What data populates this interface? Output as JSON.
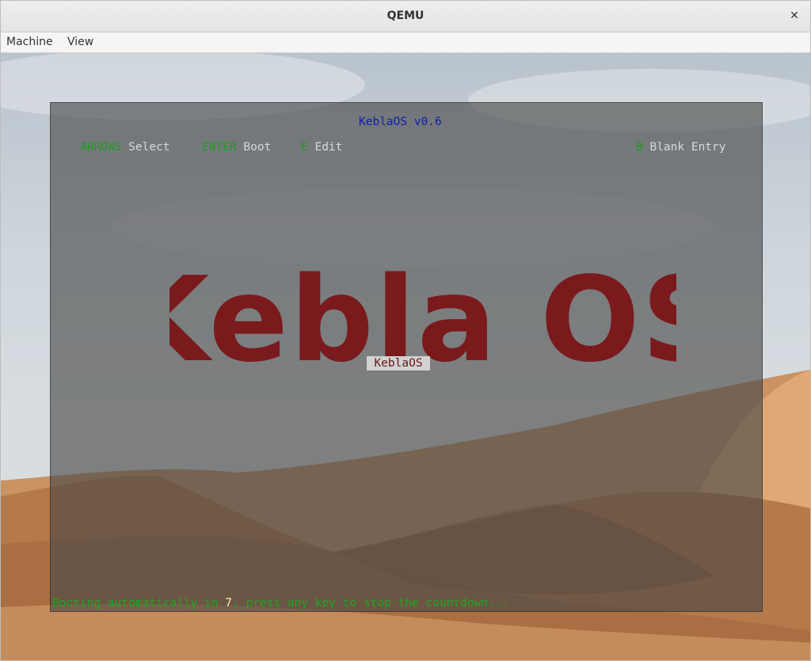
{
  "window": {
    "title": "QEMU",
    "close_glyph": "✕"
  },
  "menu": {
    "items": [
      {
        "label": "Machine"
      },
      {
        "label": "View"
      }
    ]
  },
  "boot": {
    "title": "KeblaOS v0.6",
    "hints": [
      {
        "key": "ARROWS",
        "action": "Select"
      },
      {
        "key": "ENTER",
        "action": "Boot"
      },
      {
        "key": "E",
        "action": "Edit"
      },
      {
        "key": "B",
        "action": "Blank Entry"
      }
    ],
    "logo_text": "Kebla OS",
    "entries": [
      {
        "label": "KeblaOS",
        "selected": true
      }
    ],
    "countdown": {
      "prefix": "Booting automatically in ",
      "seconds": "7",
      "suffix": ", press any key to stop the countdown..."
    }
  },
  "colors": {
    "key_hint": "#1f9a1f",
    "boot_title": "#0c1fa8",
    "logo": "#7a1a1c",
    "countdown": "#1fa51f"
  }
}
